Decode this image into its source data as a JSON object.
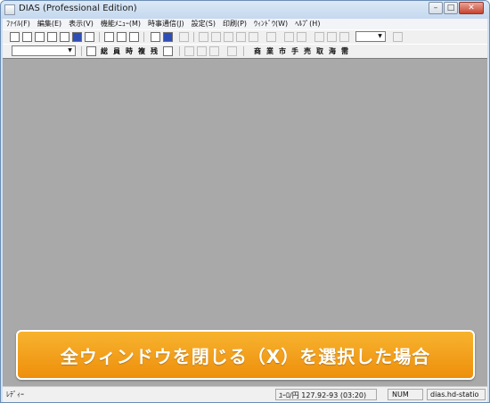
{
  "window": {
    "title": "DIAS (Professional Edition)"
  },
  "window_controls": {
    "minimize": "–",
    "maximize": "□",
    "close": "✕"
  },
  "menu": [
    {
      "label": "ﾌｧｲﾙ(F)"
    },
    {
      "label": "編集(E)"
    },
    {
      "label": "表示(V)"
    },
    {
      "label": "機能ﾒﾆｭｰ(M)"
    },
    {
      "label": "時事通信(J)"
    },
    {
      "label": "設定(S)"
    },
    {
      "label": "印刷(P)"
    },
    {
      "label": "ｳｨﾝﾄﾞｳ(W)"
    },
    {
      "label": "ﾍﾙﾌﾟ(H)"
    }
  ],
  "toolbar2": {
    "kanji_buttons": [
      "総",
      "員",
      "時",
      "複",
      "残"
    ],
    "kanji_buttons_right": [
      "商",
      "業",
      "市",
      "手",
      "売",
      "取",
      "海",
      "需"
    ]
  },
  "statusbar": {
    "ready": "ﾚﾃﾞｨｰ",
    "rate": "ﾕｰﾛ/円  127.92-93  (03:20)",
    "num": "NUM",
    "host": "dias.hd-statio"
  },
  "banner": {
    "text": "全ウィンドウを閉じる（X）を選択した場合"
  },
  "colors": {
    "banner": "#f2a01c",
    "client_area": "#a9a9a9",
    "title_bar": "#cfe0f2"
  }
}
